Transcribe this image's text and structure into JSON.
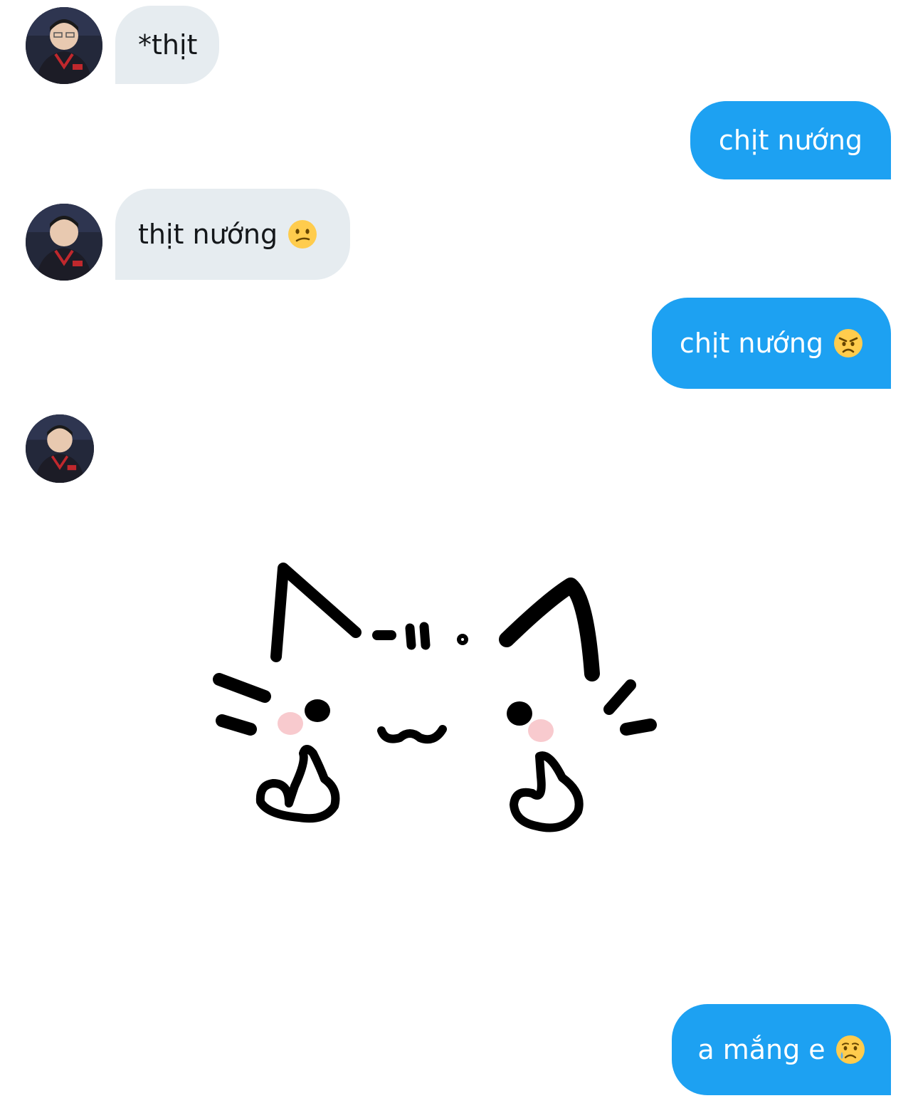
{
  "messages": [
    {
      "id": 1,
      "direction": "in",
      "text": "*thịt",
      "emoji": ""
    },
    {
      "id": 2,
      "direction": "out",
      "text": "chịt nướng",
      "emoji": ""
    },
    {
      "id": 3,
      "direction": "in",
      "text": "thịt nướng",
      "emoji": "confused-face"
    },
    {
      "id": 4,
      "direction": "out",
      "text": "chịt nướng",
      "emoji": "angry-face"
    },
    {
      "id": 5,
      "direction": "in",
      "sticker": "cat-middle-finger-sticker"
    },
    {
      "id": 6,
      "direction": "out",
      "text": "a mắng e",
      "emoji": "crying-face"
    }
  ],
  "colors": {
    "incoming_bubble": "#e6ecf0",
    "outgoing_bubble": "#1da1f2",
    "incoming_text": "#14171a",
    "outgoing_text": "#ffffff",
    "background": "#ffffff"
  }
}
